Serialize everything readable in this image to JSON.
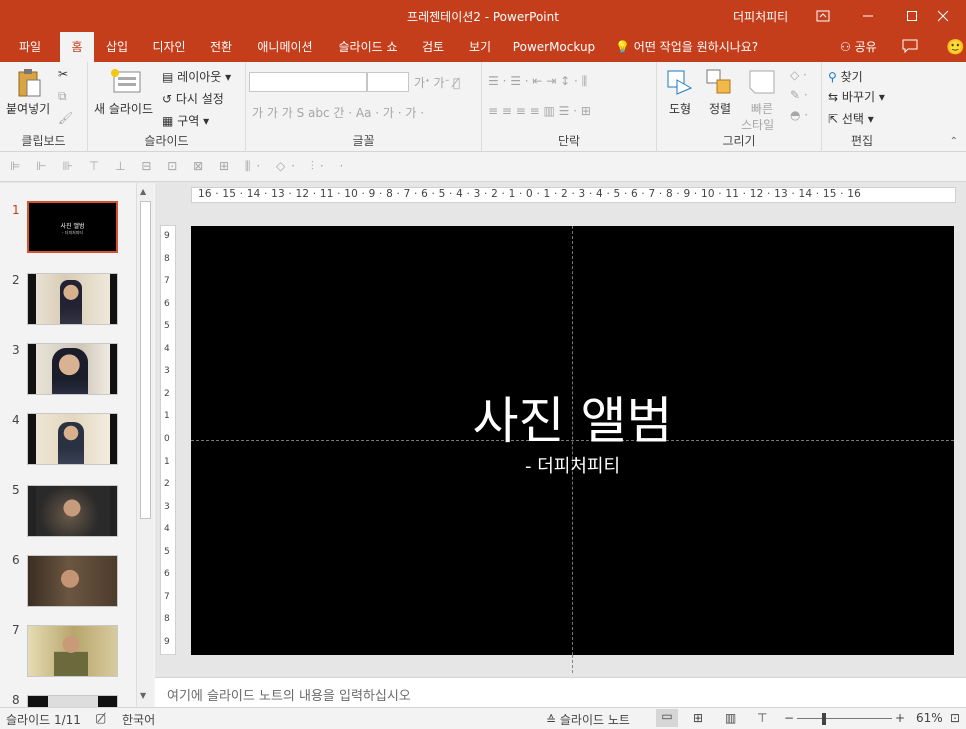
{
  "window": {
    "title": "프레젠테이션2 - PowerPoint",
    "user": "더피처피티",
    "accent": "#c43e1c"
  },
  "tabs": [
    {
      "label": "파일",
      "active": false
    },
    {
      "label": "홈",
      "active": true
    },
    {
      "label": "삽입",
      "active": false
    },
    {
      "label": "디자인",
      "active": false
    },
    {
      "label": "전환",
      "active": false
    },
    {
      "label": "애니메이션",
      "active": false
    },
    {
      "label": "슬라이드 쇼",
      "active": false
    },
    {
      "label": "검토",
      "active": false
    },
    {
      "label": "보기",
      "active": false
    },
    {
      "label": "PowerMockup",
      "active": false
    }
  ],
  "tell_me": "어떤 작업을 원하시나요?",
  "share_label": "공유",
  "ribbon": {
    "clipboard": {
      "paste": "붙여넣기",
      "label": "클립보드"
    },
    "slides": {
      "new_slide": "새 슬라이드",
      "layout": "레이아웃",
      "reset": "다시 설정",
      "section": "구역",
      "label": "슬라이드"
    },
    "font": {
      "label": "글꼴"
    },
    "paragraph": {
      "label": "단락"
    },
    "drawing": {
      "shapes": "도형",
      "arrange": "정렬",
      "quick_styles_1": "빠른",
      "quick_styles_2": "스타일",
      "label": "그리기"
    },
    "editing": {
      "find": "찾기",
      "replace": "바꾸기",
      "select": "선택",
      "label": "편집"
    }
  },
  "thumbnails": [
    {
      "number": "1",
      "title": "사진 앨범",
      "subtitle": "- 더피처피티",
      "selected": true
    },
    {
      "number": "2",
      "selected": false
    },
    {
      "number": "3",
      "selected": false
    },
    {
      "number": "4",
      "selected": false
    },
    {
      "number": "5",
      "selected": false
    },
    {
      "number": "6",
      "selected": false
    },
    {
      "number": "7",
      "selected": false
    },
    {
      "number": "8",
      "selected": false
    }
  ],
  "rulers": {
    "horizontal": "16 · 15 · 14 · 13 · 12 · 11 · 10 · 9 · 8 · 7 · 6 · 5 · 4 · 3 · 2 · 1 · 0 · 1 · 2 · 3 · 4 · 5 · 6 · 7 · 8 · 9 · 10 · 11 · 12 · 13 · 14 · 15 · 16",
    "vertical": [
      "9",
      "8",
      "7",
      "6",
      "5",
      "4",
      "3",
      "2",
      "1",
      "0",
      "1",
      "2",
      "3",
      "4",
      "5",
      "6",
      "7",
      "8",
      "9"
    ]
  },
  "slide": {
    "title": "사진 앨범",
    "subtitle": "- 더피처피티"
  },
  "notes_placeholder": "여기에 슬라이드 노트의 내용을 입력하십시오",
  "status": {
    "slide_count": "슬라이드 1/11",
    "language": "한국어",
    "notes_button": "슬라이드 노트",
    "zoom": "61%",
    "zoom_fraction": 0.61
  }
}
